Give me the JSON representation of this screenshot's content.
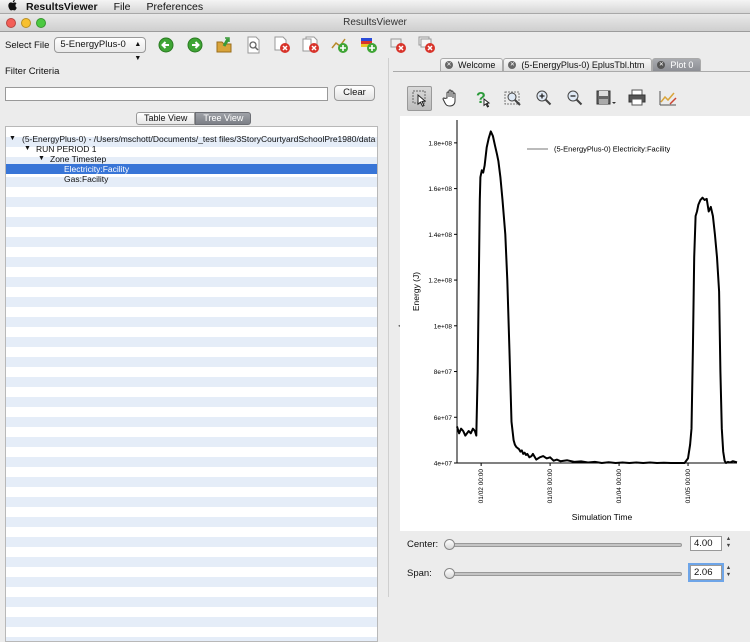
{
  "menubar": {
    "app": "ResultsViewer",
    "items": [
      "File",
      "Preferences"
    ]
  },
  "window": {
    "title": "ResultsViewer"
  },
  "toolbar": {
    "select_label": "Select File",
    "selected_file": "5-EnergyPlus-0"
  },
  "filter": {
    "label": "Filter Criteria",
    "value": "",
    "clear_label": "Clear"
  },
  "view_tabs": {
    "table": "Table View",
    "tree": "Tree View",
    "active": "Tree View"
  },
  "tree": {
    "rows": [
      {
        "label": "(5-EnergyPlus-0) - /Users/mschott/Documents/_test files/3StoryCourtyardSchoolPre1980/data"
      },
      {
        "label": "RUN PERIOD 1"
      },
      {
        "label": "Zone Timestep"
      },
      {
        "label": "Electricity:Facility"
      },
      {
        "label": "Gas:Facility"
      }
    ]
  },
  "tabs": [
    "Welcome",
    "(5-EnergyPlus-0) EplusTbl.htm",
    "Plot 0"
  ],
  "active_tab": "Plot 0",
  "controls": {
    "center_label": "Center:",
    "center_value": "4.00",
    "span_label": "Span:",
    "span_value": "2.06",
    "center_fraction": 0.0,
    "span_fraction": 0.0
  },
  "chart_data": {
    "type": "line",
    "xlabel": "Simulation Time",
    "ylabel": "Energy (J)",
    "x_ticks": [
      "01/02 00:00",
      "01/03 00:00",
      "01/04 00:00",
      "01/05 00:00",
      "01/06 00:00"
    ],
    "y_ticks": [
      "4e+07",
      "6e+07",
      "8e+07",
      "1e+08",
      "1.2e+08",
      "1.4e+08",
      "1.6e+08",
      "1.8e+08"
    ],
    "xlim": [
      0.0,
      4.06
    ],
    "ylim": [
      40000000,
      190000000
    ],
    "legend": "top-right",
    "series": [
      {
        "name": "(5-EnergyPlus-0) Electricity:Facility",
        "color": "#000000",
        "x": [
          0.0,
          0.03,
          0.06,
          0.09,
          0.12,
          0.17,
          0.2,
          0.23,
          0.26,
          0.28,
          0.3,
          0.32,
          0.33,
          0.34,
          0.36,
          0.38,
          0.4,
          0.43,
          0.46,
          0.49,
          0.52,
          0.55,
          0.58,
          0.6,
          0.63,
          0.66,
          0.7,
          0.73,
          0.76,
          0.79,
          0.82,
          0.84,
          0.86,
          0.88,
          0.9,
          0.92,
          0.94,
          0.96,
          0.98,
          1.0,
          1.02,
          1.05,
          1.08,
          1.1,
          1.15,
          1.2,
          1.25,
          1.3,
          1.35,
          1.4,
          1.45,
          1.5,
          1.6,
          1.7,
          1.8,
          1.9,
          2.0,
          2.1,
          2.2,
          2.3,
          2.4,
          2.5,
          2.6,
          2.7,
          2.8,
          2.9,
          3.0,
          3.1,
          3.2,
          3.3,
          3.35,
          3.38,
          3.4,
          3.42,
          3.44,
          3.46,
          3.48,
          3.5,
          3.53,
          3.56,
          3.59,
          3.62,
          3.65,
          3.68,
          3.71,
          3.74,
          3.77,
          3.8,
          3.82,
          3.84,
          3.86,
          3.88,
          3.9,
          3.93,
          3.96,
          4.0,
          4.06
        ],
        "y": [
          56000000,
          53000000,
          55000000,
          54000000,
          52000000,
          54000000,
          53000000,
          55000000,
          54000000,
          52000000,
          80000000,
          130000000,
          155000000,
          165000000,
          168000000,
          167000000,
          170000000,
          178000000,
          182000000,
          185000000,
          183000000,
          179000000,
          175000000,
          172000000,
          165000000,
          155000000,
          140000000,
          120000000,
          90000000,
          58000000,
          50000000,
          48000000,
          47000000,
          46500000,
          46000000,
          45000000,
          45500000,
          44000000,
          44500000,
          43500000,
          44000000,
          42500000,
          43000000,
          44000000,
          41500000,
          42500000,
          43000000,
          42000000,
          42500000,
          41000000,
          41500000,
          40800000,
          41200000,
          40500000,
          40700000,
          40200000,
          40500000,
          40000000,
          40300000,
          40000000,
          40200000,
          40000000,
          40200000,
          40000000,
          40200000,
          40000000,
          40100000,
          40000000,
          40000000,
          40000000,
          42000000,
          48000000,
          55000000,
          90000000,
          130000000,
          148000000,
          150000000,
          153000000,
          155000000,
          156000000,
          155000000,
          155500000,
          150000000,
          152000000,
          148000000,
          140000000,
          130000000,
          115000000,
          80000000,
          55000000,
          45000000,
          41000000,
          40000000,
          40500000,
          40200000,
          40800000,
          40300000
        ]
      }
    ]
  }
}
